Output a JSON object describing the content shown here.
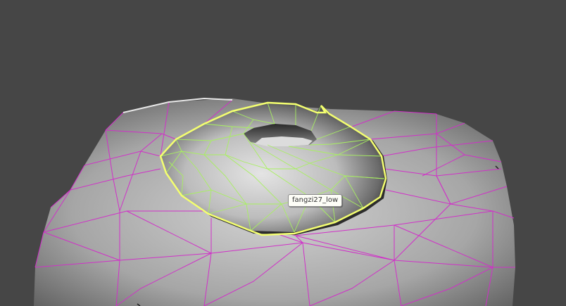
{
  "viewport": {
    "background_color": "#464646",
    "label": ""
  },
  "scene": {
    "base_mesh": {
      "wire_color": "#d030c8",
      "fill_color": "#a8a8a8",
      "selected": false
    },
    "donut_mesh": {
      "object_name": "fangzi27_low",
      "wire_color": "#a8f060",
      "outline_color": "#f4ff70",
      "fill_color": "#b4b4b4",
      "selected": true
    }
  },
  "tooltip": {
    "text": "fangzi27_low"
  }
}
